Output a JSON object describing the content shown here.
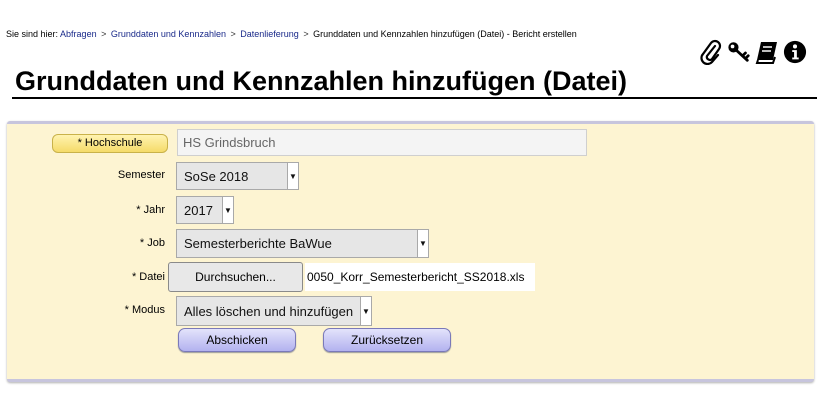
{
  "breadcrumb": {
    "prefix": "Sie sind hier:",
    "links": [
      "Abfragen",
      "Grunddaten und Kennzahlen",
      "Datenlieferung"
    ],
    "current": "Grunddaten und Kennzahlen hinzufügen (Datei) - Bericht erstellen",
    "separator": ">"
  },
  "toolbar_icons": [
    "paperclip-icon",
    "key-icon",
    "book-icon",
    "info-icon"
  ],
  "page_title": "Grunddaten und Kennzahlen hinzufügen (Datei)",
  "form": {
    "hochschule": {
      "label": "* Hochschule",
      "value": "HS Grindsbruch"
    },
    "semester": {
      "label": "Semester",
      "value": "SoSe 2018"
    },
    "jahr": {
      "label": "* Jahr",
      "value": "2017"
    },
    "job": {
      "label": "* Job",
      "value": "Semesterberichte BaWue"
    },
    "datei": {
      "label": "* Datei",
      "browse_label": "Durchsuchen...",
      "filename": "0050_Korr_Semesterbericht_SS2018.xls"
    },
    "modus": {
      "label": "* Modus",
      "value": "Alles löschen und hinzufügen"
    },
    "submit_label": "Abschicken",
    "reset_label": "Zurücksetzen"
  },
  "colors": {
    "panel_bg": "#fdf4d2",
    "link": "#1a2a8a",
    "button_bg": "#c9c8f5",
    "pill_bg": "#f8e38c"
  }
}
